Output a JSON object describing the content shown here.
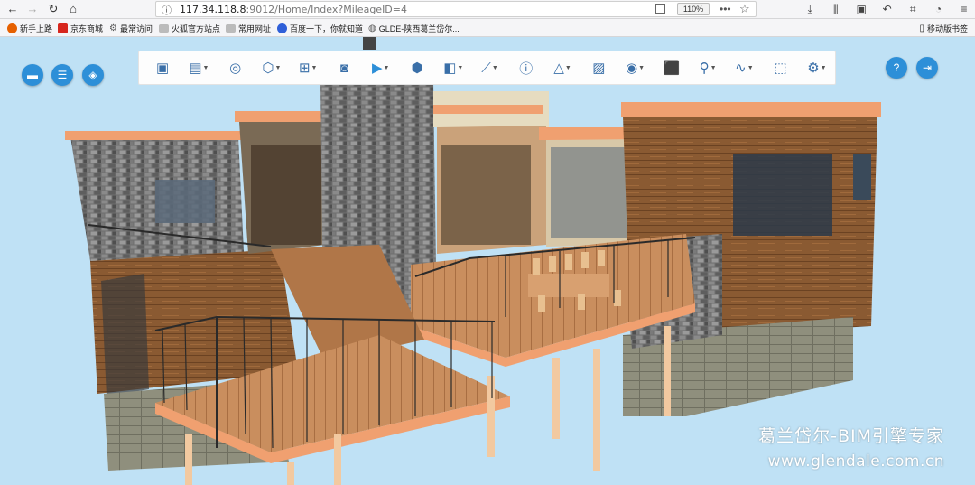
{
  "browser": {
    "url_host": "117.34.118.8",
    "url_path": ":9012/Home/Index?MileageID=4",
    "zoom": "110%",
    "bookmarks": [
      {
        "label": "新手上路",
        "icon": "firefox-icon",
        "color": "#e66000"
      },
      {
        "label": "京东商城",
        "icon": "jd-icon",
        "color": "#d7261d"
      },
      {
        "label": "最常访问",
        "icon": "gear-icon",
        "color": "#555555"
      },
      {
        "label": "火狐官方站点",
        "icon": "folder-icon",
        "color": "#8a8a8a"
      },
      {
        "label": "常用网址",
        "icon": "folder-icon",
        "color": "#8a8a8a"
      },
      {
        "label": "百度一下，你就知道",
        "icon": "baidu-icon",
        "color": "#2f5fd8"
      },
      {
        "label": "GLDE-陕西葛兰岱尔...",
        "icon": "globe-icon",
        "color": "#555555"
      }
    ],
    "mobile_bookmarks": "移动版书签"
  },
  "viewer": {
    "accent": "#2d8fd8",
    "left_buttons": [
      "folder-icon",
      "structure-tree-icon",
      "layers-icon"
    ],
    "right_buttons": [
      "help-icon",
      "exit-icon"
    ],
    "toolbar": [
      {
        "icon": "image-settings-icon",
        "dropdown": false
      },
      {
        "icon": "model-dropdown-icon",
        "dropdown": true
      },
      {
        "icon": "roam-icon",
        "dropdown": false
      },
      {
        "icon": "view-cube-icon",
        "dropdown": true
      },
      {
        "icon": "grid-icon",
        "dropdown": true
      },
      {
        "icon": "camera-icon",
        "dropdown": false
      },
      {
        "icon": "play-icon",
        "dropdown": true
      },
      {
        "icon": "box-icon",
        "dropdown": false
      },
      {
        "icon": "section-icon",
        "dropdown": true
      },
      {
        "icon": "measure-icon",
        "dropdown": true
      },
      {
        "icon": "info-icon",
        "dropdown": false
      },
      {
        "icon": "angle-icon",
        "dropdown": true
      },
      {
        "icon": "picture-icon",
        "dropdown": false
      },
      {
        "icon": "visibility-icon",
        "dropdown": true
      },
      {
        "icon": "cube-icon",
        "dropdown": false
      },
      {
        "icon": "location-list-icon",
        "dropdown": true
      },
      {
        "icon": "chart-line-icon",
        "dropdown": true
      },
      {
        "icon": "select-icon",
        "dropdown": false
      },
      {
        "icon": "settings-icon",
        "dropdown": true
      }
    ]
  },
  "watermark": {
    "line1": "葛兰岱尔-BIM引擎专家",
    "line2": "www.glendale.com.cn"
  }
}
